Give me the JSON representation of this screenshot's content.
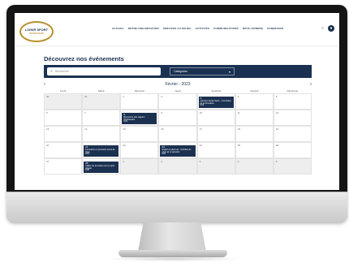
{
  "header": {
    "logo_line1": "LOISIR SPORT",
    "logo_line2": "OUTAOUAIS",
    "nav": [
      "ACCUEIL",
      "NOTRE ORGANISATION",
      "SERVICES AU MILIEU",
      "ACTIVITÉS",
      "COMMUNICATIONS",
      "NOUS JOINDRE",
      "CONNEXION"
    ],
    "search_icon": "search-icon",
    "avatar_text": "●"
  },
  "page": {
    "title": "Découvrez nos événements"
  },
  "filters": {
    "search_placeholder": "Recherche",
    "category_label": "Catégories",
    "chevron": "▾"
  },
  "calendar": {
    "month": "Février - 2023",
    "prev": "‹",
    "next": "›",
    "weekdays": [
      "Lundi",
      "Mardi",
      "Mercredi",
      "Jeudi",
      "Vendredi",
      "Samedi",
      "Dimanche"
    ],
    "weeks": [
      [
        {
          "n": "30",
          "out": true
        },
        {
          "n": "31",
          "out": true
        },
        {
          "n": "1"
        },
        {
          "n": "2"
        },
        {
          "n": "3",
          "event": {
            "title": "Journée Santé Sport – Formation de la formation",
            "time": "9:00"
          }
        },
        {
          "n": "4"
        },
        {
          "n": "5"
        }
      ],
      [
        {
          "n": "6"
        },
        {
          "n": "7"
        },
        {
          "n": "8",
          "event": {
            "title": "Rencontre des régions d'Outaouais",
            "time": "9:00"
          }
        },
        {
          "n": "9"
        },
        {
          "n": "10"
        },
        {
          "n": "11"
        },
        {
          "n": "12"
        }
      ],
      [
        {
          "n": "13"
        },
        {
          "n": "14"
        },
        {
          "n": "15"
        },
        {
          "n": "16"
        },
        {
          "n": "17"
        },
        {
          "n": "18"
        },
        {
          "n": "19"
        }
      ],
      [
        {
          "n": "20"
        },
        {
          "n": "21",
          "event": {
            "title": "Formation en premiers soins de base",
            "time": "9:00"
          }
        },
        {
          "n": "22"
        },
        {
          "n": "23",
          "event": {
            "title": "Atelier en plein air : Activités de plein air et sécurité",
            "time": "9:00"
          }
        },
        {
          "n": "24"
        },
        {
          "n": "25"
        },
        {
          "n": "26"
        }
      ],
      [
        {
          "n": "27"
        },
        {
          "n": "28",
          "event": {
            "title": "Atelier de formation sur le sport adapté",
            "time": "9:00"
          }
        },
        {
          "n": "1",
          "out": true
        },
        {
          "n": "2",
          "out": true
        },
        {
          "n": "3",
          "out": true
        },
        {
          "n": "4",
          "out": true
        },
        {
          "n": "5",
          "out": true
        }
      ]
    ]
  },
  "colors": {
    "primary": "#1b3151",
    "accent": "#b8912e"
  }
}
